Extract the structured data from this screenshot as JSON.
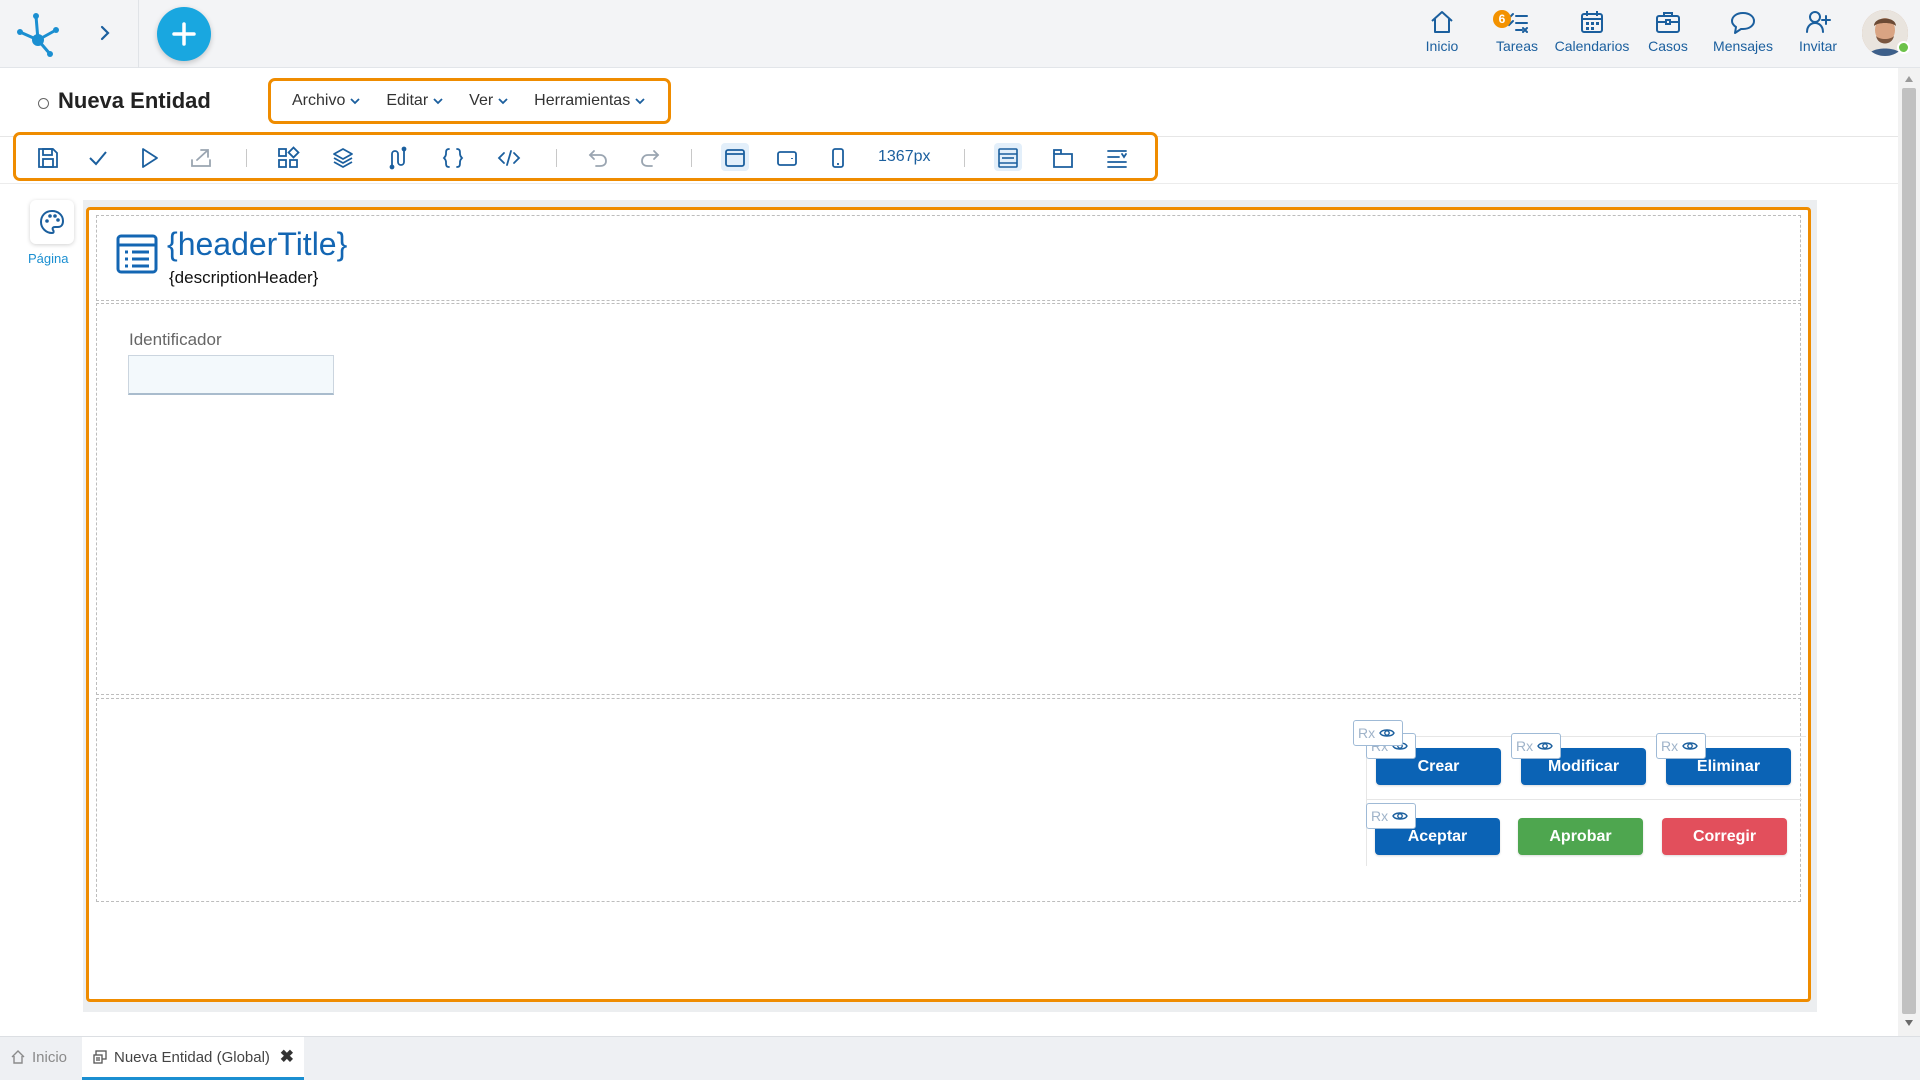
{
  "topbar": {
    "nav": [
      {
        "id": "inicio",
        "label": "Inicio",
        "icon": "home-icon"
      },
      {
        "id": "tareas",
        "label": "Tareas",
        "icon": "tasks-icon",
        "badge": "6"
      },
      {
        "id": "calendarios",
        "label": "Calendarios",
        "icon": "calendar-icon"
      },
      {
        "id": "casos",
        "label": "Casos",
        "icon": "briefcase-icon"
      },
      {
        "id": "mensajes",
        "label": "Mensajes",
        "icon": "chat-icon"
      },
      {
        "id": "invitar",
        "label": "Invitar",
        "icon": "invite-user-icon"
      }
    ]
  },
  "page": {
    "title": "Nueva Entidad"
  },
  "menu": {
    "items": [
      "Archivo",
      "Editar",
      "Ver",
      "Herramientas"
    ]
  },
  "toolbar": {
    "width_value": "1367px"
  },
  "palette": {
    "label": "Página"
  },
  "form": {
    "header_title": "{headerTitle}",
    "header_description": "{descriptionHeader}",
    "field_label": "Identificador",
    "field_value": ""
  },
  "actions": {
    "rx_label": "Rx",
    "buttons": [
      {
        "label": "Crear",
        "color": "#0b63b5"
      },
      {
        "label": "Modificar",
        "color": "#0b63b5"
      },
      {
        "label": "Eliminar",
        "color": "#0b63b5"
      },
      {
        "label": "Aceptar",
        "color": "#0b63b5"
      },
      {
        "label": "Aprobar",
        "color": "#4ea64f"
      },
      {
        "label": "Corregir",
        "color": "#e24f5c"
      }
    ]
  },
  "bottom_tabs": {
    "home": "Inicio",
    "active": "Nueva Entidad (Global)"
  },
  "colors": {
    "accent": "#19a7e0",
    "highlight_border": "#ef8c00",
    "primary": "#0b63b5"
  }
}
